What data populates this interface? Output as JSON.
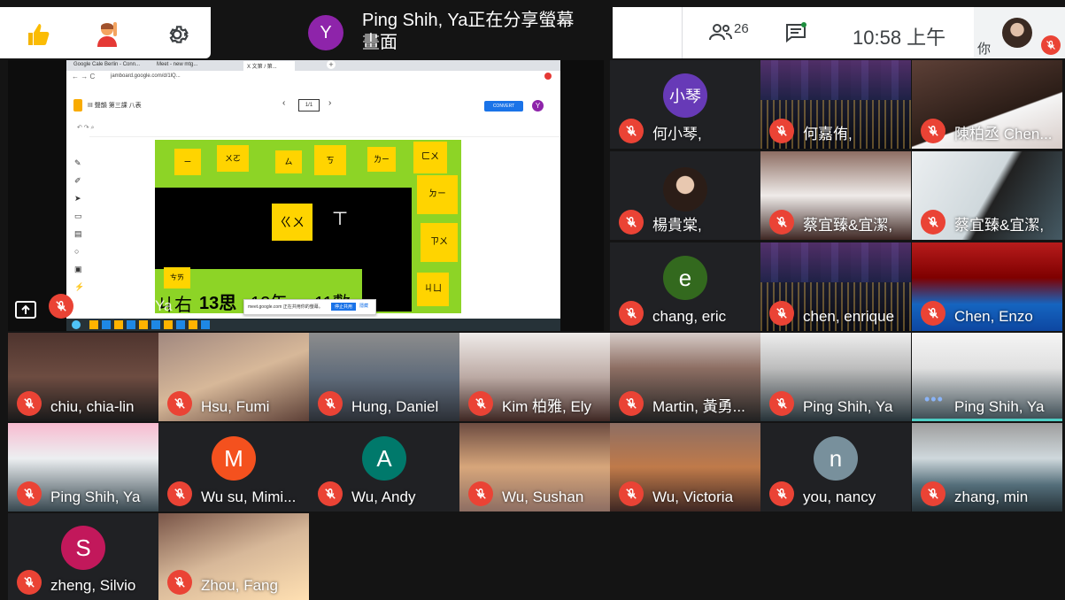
{
  "toolbar": {
    "presenter_initial": "Y",
    "presenter_text_line1": "Ping Shih, Ya正在分享螢幕",
    "presenter_text_line2": "畫面",
    "participants_count": "26",
    "clock": "10:58 上午",
    "self_label": "你"
  },
  "share": {
    "presenter_label": "Ping Shih, Ya",
    "browser_tab_1": "Google Cale Berlin - Conn...",
    "browser_tab_2": "Meet - new mtg...",
    "browser_tab_3": "X 文第 / 第...",
    "address": "jamboard.google.com/d/1lQ...",
    "doc_title": "III 聲韻 第三課 八表",
    "page_counter": "1/1",
    "panel_button": "CONVERT",
    "board_texts": [
      "10敢",
      "《ㄎ",
      "ㄒ",
      "ㄐ右",
      "13思",
      "12矢",
      "11敷"
    ],
    "notes": [
      "ㄧ",
      "ㄨㄛ",
      "ㄙ",
      "ㄎ",
      "ㄌㄧ",
      "ㄈㄨ",
      "ㄉㄧ",
      "ㄍㄨ",
      "ㄗㄨ",
      "ㄘㄞ",
      "ㄐㄩ"
    ],
    "notify_text": "meet.google.com 正在共用你的螢幕。",
    "notify_btn1": "停止共用",
    "notify_btn2": "隱藏"
  },
  "participants": [
    {
      "name": "何小琴,",
      "initial": "小琴",
      "color": "#673ab7"
    },
    {
      "name": "何嘉侑,"
    },
    {
      "name": "陳柏丞 Chen..."
    },
    {
      "name": "楊貴棠,"
    },
    {
      "name": "蔡宜臻&宜潔,"
    },
    {
      "name": "蔡宜臻&宜潔,"
    },
    {
      "name": "chang, eric",
      "initial": "e",
      "color": "#33691e"
    },
    {
      "name": "chen, enrique"
    },
    {
      "name": "Chen, Enzo"
    },
    {
      "name": "chiu, chia-lin"
    },
    {
      "name": "Hsu, Fumi"
    },
    {
      "name": "Hung, Daniel"
    },
    {
      "name": "Kim 柏雅, Ely"
    },
    {
      "name": "Martin, 黃勇..."
    },
    {
      "name": "Ping Shih, Ya"
    },
    {
      "name": "Ping Shih, Ya"
    },
    {
      "name": "Ping Shih, Ya"
    },
    {
      "name": "Wu su, Mimi...",
      "initial": "M",
      "color": "#f4511e"
    },
    {
      "name": "Wu, Andy",
      "initial": "A",
      "color": "#00796b"
    },
    {
      "name": "Wu, Sushan"
    },
    {
      "name": "Wu, Victoria"
    },
    {
      "name": "you, nancy",
      "initial": "n",
      "color": "#78909c"
    },
    {
      "name": "zhang, min"
    },
    {
      "name": "zheng, Silvio",
      "initial": "S",
      "color": "#c2185b"
    },
    {
      "name": "Zhou, Fang"
    }
  ]
}
